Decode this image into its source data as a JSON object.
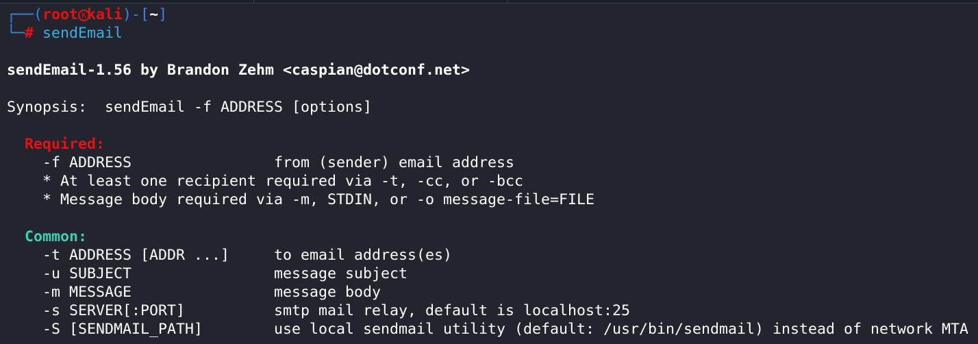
{
  "prompt": {
    "user": "root",
    "host": "kali",
    "cwd": "~",
    "symbol": "#",
    "command": "sendEmail",
    "logo_icon": "kali-dragon-icon",
    "logo_letter": "K"
  },
  "output": {
    "banner": "sendEmail-1.56 by Brandon Zehm <caspian@dotconf.net>",
    "synopsis": "Synopsis:  sendEmail -f ADDRESS [options]",
    "required": {
      "heading": "Required:",
      "options": [
        {
          "flag": "-f ADDRESS",
          "desc": "from (sender) email address"
        }
      ],
      "notes": [
        "* At least one recipient required via -t, -cc, or -bcc",
        "* Message body required via -m, STDIN, or -o message-file=FILE"
      ]
    },
    "common": {
      "heading": "Common:",
      "options": [
        {
          "flag": "-t ADDRESS [ADDR ...]",
          "desc": "to email address(es)"
        },
        {
          "flag": "-u SUBJECT",
          "desc": "message subject"
        },
        {
          "flag": "-m MESSAGE",
          "desc": "message body"
        },
        {
          "flag": "-s SERVER[:PORT]",
          "desc": "smtp mail relay, default is localhost:25"
        },
        {
          "flag": "-S [SENDMAIL_PATH]",
          "desc": "use local sendmail utility (default: /usr/bin/sendmail) instead of network MTA"
        }
      ]
    }
  },
  "colors": {
    "background": "#22252e",
    "prompt_frame": "#3b82e6",
    "root": "#e81010",
    "command": "#3eaee0",
    "common_heading": "#3ad1b0"
  }
}
